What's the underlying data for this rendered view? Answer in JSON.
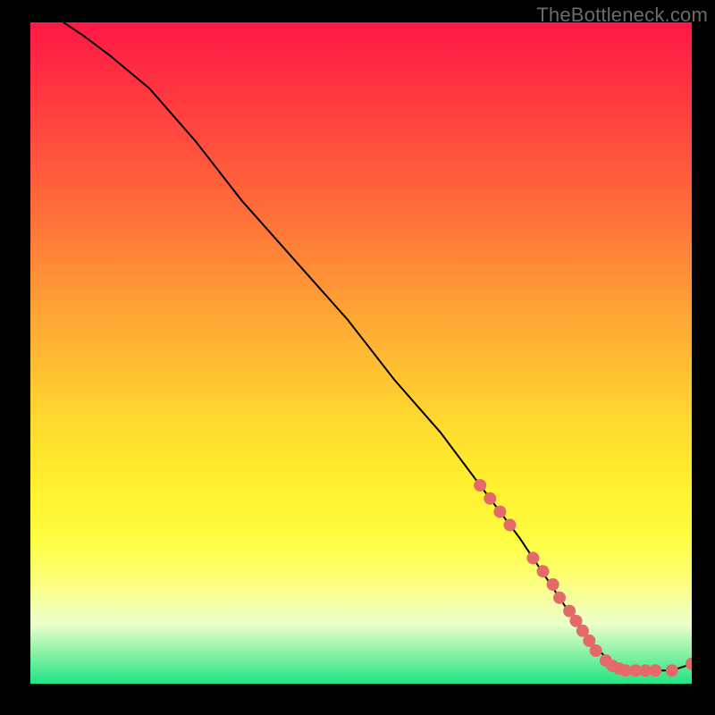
{
  "watermark": "TheBottleneck.com",
  "colors": {
    "gradient_top": "#ff1846",
    "gradient_mid": "#ffd82f",
    "gradient_bottom": "#20e482",
    "curve": "#000000",
    "markers": "#e46a6a",
    "frame": "#000000"
  },
  "chart_data": {
    "type": "line",
    "title": "",
    "xlabel": "",
    "ylabel": "",
    "xlim": [
      0,
      100
    ],
    "ylim": [
      0,
      100
    ],
    "legend": "none",
    "grid": false,
    "series": [
      {
        "name": "curve",
        "x": [
          5,
          8,
          12,
          18,
          25,
          32,
          40,
          48,
          55,
          62,
          68,
          74,
          78,
          82,
          85,
          88,
          91,
          94,
          97,
          100
        ],
        "y": [
          100,
          98,
          95,
          90,
          82,
          73,
          64,
          55,
          46,
          38,
          30,
          22,
          16,
          10,
          6,
          3,
          2,
          2,
          2,
          3
        ]
      }
    ],
    "markers": [
      {
        "x": 68,
        "y": 30
      },
      {
        "x": 69.5,
        "y": 28
      },
      {
        "x": 71,
        "y": 26
      },
      {
        "x": 72.5,
        "y": 24
      },
      {
        "x": 76,
        "y": 19
      },
      {
        "x": 77.5,
        "y": 17
      },
      {
        "x": 79,
        "y": 15
      },
      {
        "x": 80,
        "y": 13
      },
      {
        "x": 81.5,
        "y": 11
      },
      {
        "x": 82.5,
        "y": 9.5
      },
      {
        "x": 83.5,
        "y": 8
      },
      {
        "x": 84.5,
        "y": 6.5
      },
      {
        "x": 85.5,
        "y": 5
      },
      {
        "x": 87,
        "y": 3.5
      },
      {
        "x": 88,
        "y": 2.7
      },
      {
        "x": 89,
        "y": 2.3
      },
      {
        "x": 90,
        "y": 2
      },
      {
        "x": 91.5,
        "y": 2
      },
      {
        "x": 93,
        "y": 2
      },
      {
        "x": 94.5,
        "y": 2
      },
      {
        "x": 97,
        "y": 2
      },
      {
        "x": 100,
        "y": 3
      }
    ]
  }
}
